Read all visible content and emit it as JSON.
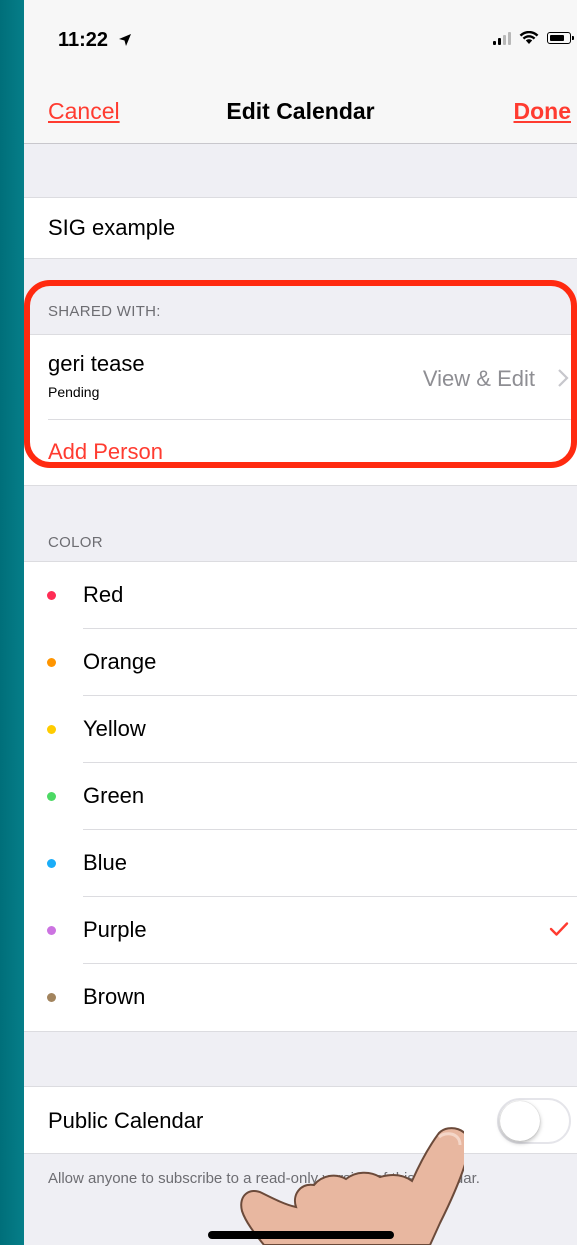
{
  "status_bar": {
    "time": "11:22",
    "location_icon": "location-arrow-icon",
    "signal_icon": "cellular-signal-icon",
    "wifi_icon": "wifi-icon",
    "battery_icon": "battery-icon"
  },
  "navbar": {
    "cancel_label": "Cancel",
    "title": "Edit Calendar",
    "done_label": "Done"
  },
  "calendar": {
    "name": "SIG example"
  },
  "shared_with": {
    "header": "SHARED WITH:",
    "people": [
      {
        "name": "geri tease",
        "status": "Pending",
        "permission": "View & Edit"
      }
    ],
    "add_person_label": "Add Person"
  },
  "color_section": {
    "header": "COLOR",
    "options": [
      {
        "label": "Red",
        "color": "#ff2d55",
        "selected": false
      },
      {
        "label": "Orange",
        "color": "#ff9500",
        "selected": false
      },
      {
        "label": "Yellow",
        "color": "#ffcc00",
        "selected": false
      },
      {
        "label": "Green",
        "color": "#4cd964",
        "selected": false
      },
      {
        "label": "Blue",
        "color": "#1badf8",
        "selected": false
      },
      {
        "label": "Purple",
        "color": "#cc73e1",
        "selected": true
      },
      {
        "label": "Brown",
        "color": "#a2845e",
        "selected": false
      }
    ]
  },
  "public_calendar": {
    "label": "Public Calendar",
    "enabled": false,
    "note": "Allow anyone to subscribe to a read-only version of this calendar."
  },
  "colors": {
    "accent": "#ff3b30",
    "highlight_border": "#ff2a10",
    "background_teal": "#148f99"
  }
}
